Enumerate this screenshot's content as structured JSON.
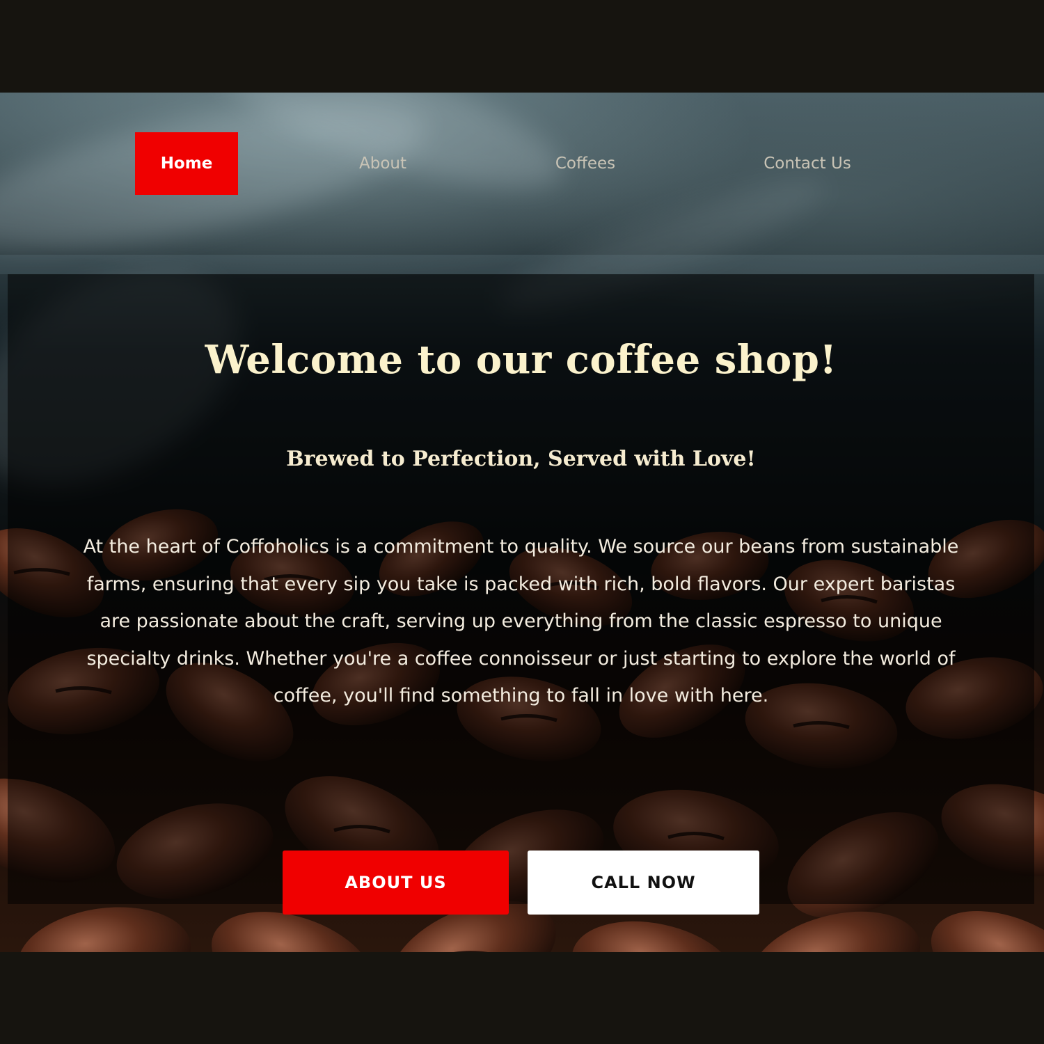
{
  "colors": {
    "accent": "#f00000",
    "title_text": "#fbf2cc",
    "outer_background": "#16140f"
  },
  "navbar": {
    "items": [
      {
        "label": "Home",
        "active": true
      },
      {
        "label": "About",
        "active": false
      },
      {
        "label": "Coffees",
        "active": false
      },
      {
        "label": "Contact Us",
        "active": false
      }
    ]
  },
  "hero": {
    "title": "Welcome to our coffee shop!",
    "subtitle": "Brewed to Perfection, Served with Love!",
    "body": "At the heart of Coffoholics is a commitment to quality. We source our beans from sustainable farms, ensuring that every sip you take is packed with rich, bold flavors. Our expert baristas are passionate about the craft, serving up everything from the classic espresso to unique specialty drinks. Whether you're a coffee connoisseur or just starting to explore the world of coffee, you'll find something to fall in love with here.",
    "buttons": {
      "about": "ABOUT US",
      "call": "CALL NOW"
    }
  }
}
